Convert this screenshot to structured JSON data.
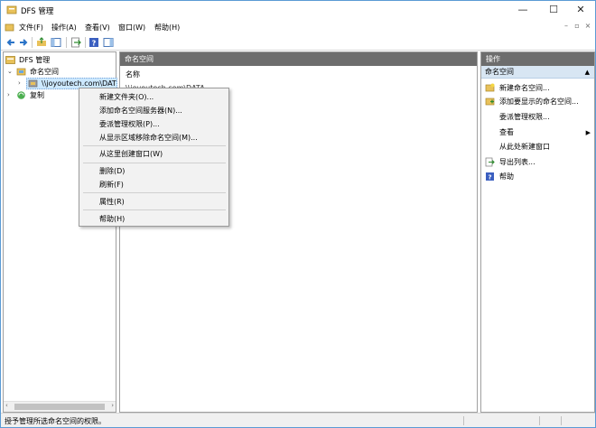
{
  "window": {
    "title": "DFS 管理",
    "minimize": "—",
    "maximize": "☐",
    "close": "✕"
  },
  "menubar": {
    "items": [
      "文件(F)",
      "操作(A)",
      "查看(V)",
      "窗口(W)",
      "帮助(H)"
    ],
    "mdi": [
      "–",
      "▫",
      "×"
    ]
  },
  "tree": {
    "root": "DFS 管理",
    "namespaces": "命名空间",
    "namespace_item": "\\\\joyoutech.com\\DAT",
    "replication": "复制"
  },
  "center": {
    "header": "命名空间",
    "column_name": "名称",
    "row": "\\\\joyoutech.com\\DATA"
  },
  "actions": {
    "header": "操作",
    "subheader": "命名空间",
    "items": [
      {
        "label": "新建命名空间...",
        "icon": "new-namespace-icon"
      },
      {
        "label": "添加要显示的命名空间...",
        "icon": "add-display-namespace-icon"
      },
      {
        "label": "委派管理权限...",
        "icon": ""
      },
      {
        "label": "查看",
        "icon": "",
        "submenu": true
      },
      {
        "label": "从此处新建窗口",
        "icon": ""
      },
      {
        "label": "导出列表...",
        "icon": "export-list-icon"
      },
      {
        "label": "帮助",
        "icon": "help-icon"
      }
    ]
  },
  "context_menu": {
    "group1": [
      "新建文件夹(O)...",
      "添加命名空间服务器(N)...",
      "委派管理权限(P)...",
      "从显示区域移除命名空间(M)..."
    ],
    "group2": [
      "从这里创建窗口(W)"
    ],
    "group3": [
      "删除(D)",
      "刷新(F)"
    ],
    "group4": [
      "属性(R)"
    ],
    "group5": [
      "帮助(H)"
    ]
  },
  "status": {
    "text": "授予管理所选命名空间的权限。"
  },
  "colors": {
    "pane_header": "#6d6d6d",
    "action_subheader": "#d8e6f3",
    "selection": "#cce8ff"
  }
}
